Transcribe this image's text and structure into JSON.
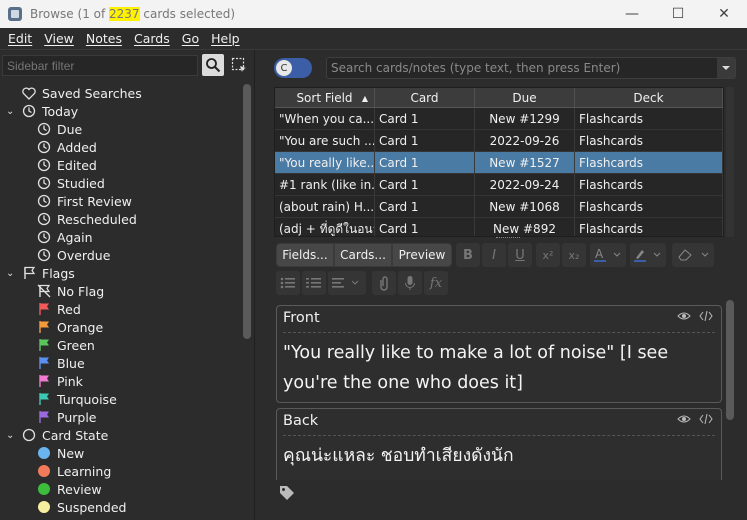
{
  "window": {
    "title_prefix": "Browse (1 of ",
    "title_count": "2237",
    "title_suffix": " cards selected)",
    "minimize_glyph": "—",
    "maximize_glyph": "☐",
    "close_glyph": "✕"
  },
  "menu": [
    "Edit",
    "View",
    "Notes",
    "Cards",
    "Go",
    "Help"
  ],
  "sidebar": {
    "filter_placeholder": "Sidebar filter",
    "items": [
      {
        "label": "Saved Searches",
        "level": 0,
        "icon": "heart-icon",
        "arrow": ""
      },
      {
        "label": "Today",
        "level": 0,
        "icon": "clock-icon",
        "arrow": "⌄"
      },
      {
        "label": "Due",
        "level": 1,
        "icon": "clock-icon"
      },
      {
        "label": "Added",
        "level": 1,
        "icon": "clock-icon"
      },
      {
        "label": "Edited",
        "level": 1,
        "icon": "clock-icon"
      },
      {
        "label": "Studied",
        "level": 1,
        "icon": "clock-icon"
      },
      {
        "label": "First Review",
        "level": 1,
        "icon": "clock-icon"
      },
      {
        "label": "Rescheduled",
        "level": 1,
        "icon": "clock-icon"
      },
      {
        "label": "Again",
        "level": 1,
        "icon": "clock-icon"
      },
      {
        "label": "Overdue",
        "level": 1,
        "icon": "clock-icon"
      },
      {
        "label": "Flags",
        "level": 0,
        "icon": "flag-icon",
        "arrow": "⌄"
      },
      {
        "label": "No Flag",
        "level": 1,
        "icon": "no-flag-icon"
      },
      {
        "label": "Red",
        "level": 1,
        "icon": "flag-icon",
        "color": "#f05a5a"
      },
      {
        "label": "Orange",
        "level": 1,
        "icon": "flag-icon",
        "color": "#f59a3c"
      },
      {
        "label": "Green",
        "level": 1,
        "icon": "flag-icon",
        "color": "#5cc45c"
      },
      {
        "label": "Blue",
        "level": 1,
        "icon": "flag-icon",
        "color": "#5b8ff0"
      },
      {
        "label": "Pink",
        "level": 1,
        "icon": "flag-icon",
        "color": "#f07ad0"
      },
      {
        "label": "Turquoise",
        "level": 1,
        "icon": "flag-icon",
        "color": "#3cc8b4"
      },
      {
        "label": "Purple",
        "level": 1,
        "icon": "flag-icon",
        "color": "#9b6ae0"
      },
      {
        "label": "Card State",
        "level": 0,
        "icon": "circle-icon",
        "arrow": "⌄"
      },
      {
        "label": "New",
        "level": 1,
        "icon": "dot-icon",
        "color": "#6ab4f0"
      },
      {
        "label": "Learning",
        "level": 1,
        "icon": "dot-icon",
        "color": "#f07a5a"
      },
      {
        "label": "Review",
        "level": 1,
        "icon": "dot-icon",
        "color": "#3cbd3c"
      },
      {
        "label": "Suspended",
        "level": 1,
        "icon": "dot-icon",
        "color": "#f5f0a0"
      }
    ]
  },
  "toggle_label": "C",
  "search_placeholder": "Search cards/notes (type text, then press Enter)",
  "table": {
    "columns": [
      "Sort Field",
      "Card",
      "Due",
      "Deck"
    ],
    "rows": [
      {
        "sort": "\"When you ca...",
        "card": "Card 1",
        "due": "New #1299",
        "deck": "Flashcards",
        "selected": false
      },
      {
        "sort": "\"You are such ...",
        "card": "Card 1",
        "due": "2022-09-26",
        "deck": "Flashcards",
        "selected": false
      },
      {
        "sort": "\"You really like...",
        "card": "Card 1",
        "due": "New #1527",
        "deck": "Flashcards",
        "selected": true
      },
      {
        "sort": "#1 rank (like in...",
        "card": "Card 1",
        "due": "2022-09-24",
        "deck": "Flashcards",
        "selected": false
      },
      {
        "sort": "(about rain) H...",
        "card": "Card 1",
        "due": "New #1068",
        "deck": "Flashcards",
        "selected": false
      },
      {
        "sort": "(adj + ที่ดูดีในอนาคต...",
        "card": "Card 1",
        "due": "New #892",
        "deck": "Flashcards",
        "selected": false
      }
    ]
  },
  "editor_toolbar": {
    "fields_label": "Fields...",
    "cards_label": "Cards...",
    "preview_label": "Preview"
  },
  "fields": [
    {
      "name": "Front",
      "content": "\"You really like to make a lot of noise\" [I see you're the one who does it]"
    },
    {
      "name": "Back",
      "content": "คุณน่ะแหละ ชอบทำเสียงดังนัก"
    }
  ]
}
